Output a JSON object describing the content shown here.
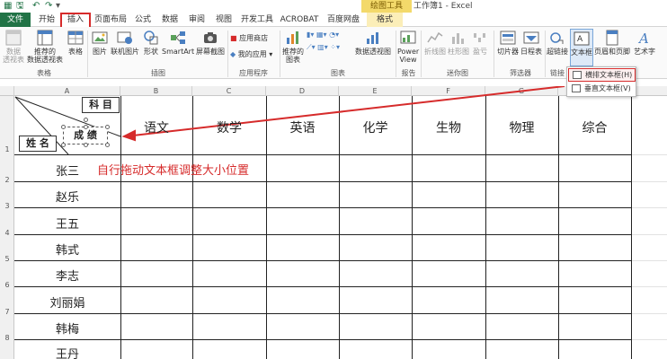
{
  "window": {
    "title": "工作簿1 - Excel",
    "context_label": "绘图工具"
  },
  "tabs": [
    {
      "id": "file",
      "label": "文件"
    },
    {
      "id": "home",
      "label": "开始"
    },
    {
      "id": "insert",
      "label": "插入"
    },
    {
      "id": "layout",
      "label": "页面布局"
    },
    {
      "id": "formula",
      "label": "公式"
    },
    {
      "id": "data",
      "label": "数据"
    },
    {
      "id": "review",
      "label": "审阅"
    },
    {
      "id": "view",
      "label": "视图"
    },
    {
      "id": "dev",
      "label": "开发工具"
    },
    {
      "id": "acrobat",
      "label": "ACROBAT"
    },
    {
      "id": "baidu",
      "label": "百度网盘"
    },
    {
      "id": "format",
      "label": "格式"
    }
  ],
  "ribbon": {
    "tables": {
      "pivot": "数据\n透视表",
      "recommended_pivot": "推荐的\n数据透视表",
      "table": "表格",
      "group": "表格"
    },
    "illustrations": {
      "picture": "图片",
      "online_picture": "联机图片",
      "shapes": "形状",
      "smartart": "SmartArt",
      "screenshot": "屏幕截图",
      "group": "插图"
    },
    "apps": {
      "store": "应用商店",
      "my_apps": "我的应用",
      "group": "应用程序"
    },
    "charts": {
      "recommended": "推荐的\n图表",
      "pivot_chart": "数据透视图",
      "group": "图表"
    },
    "reports": {
      "power_view": "Power\nView",
      "group": "报告"
    },
    "sparklines": {
      "line": "折线图",
      "column": "柱形图",
      "winloss": "盈亏",
      "group": "迷你图"
    },
    "filters": {
      "slicer": "切片器",
      "timeline": "日程表",
      "group": "筛选器"
    },
    "links": {
      "hyperlink": "超链接",
      "group": "链接"
    },
    "text": {
      "textbox": "文本框",
      "header_footer": "页眉和页脚",
      "wordart": "艺术字"
    }
  },
  "textbox_dropdown": {
    "horizontal": "横排文本框(H)",
    "vertical": "垂直文本框(V)"
  },
  "sheet": {
    "columns": [
      "A",
      "B",
      "C",
      "D",
      "E",
      "F",
      "G",
      "H"
    ],
    "rows": [
      "1",
      "2",
      "3",
      "4",
      "5",
      "6",
      "7",
      "8"
    ],
    "header_subjects": [
      "语文",
      "数学",
      "英语",
      "化学",
      "生物",
      "物理",
      "综合"
    ],
    "textbox_subject": "科 目",
    "textbox_score": "成 绩",
    "textbox_name": "姓 名",
    "names": [
      "张三",
      "赵乐",
      "王五",
      "韩式",
      "李志",
      "刘丽娟",
      "韩梅",
      "王丹"
    ]
  },
  "annotation": "自行拖动文本框调整大小位置",
  "colors": {
    "excel_green": "#217346",
    "highlight_red": "#d62b2b",
    "context_yellow": "#f3d96a"
  }
}
